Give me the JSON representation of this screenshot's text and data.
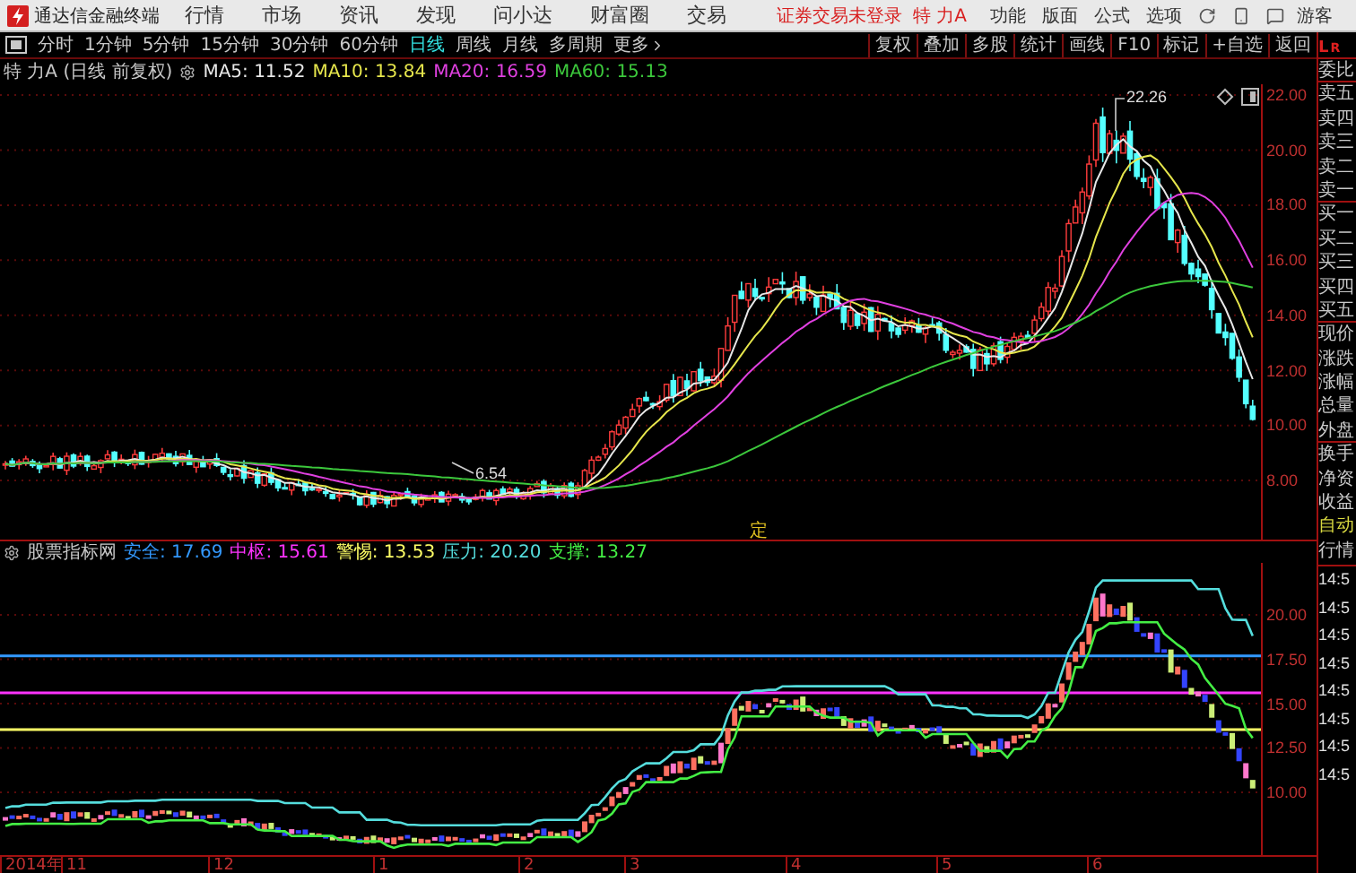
{
  "app_bar": {
    "title": "通达信金融终端",
    "menu": [
      "行情",
      "市场",
      "资讯",
      "发现",
      "问小达",
      "财富圈",
      "交易"
    ],
    "login_status": "证券交易未登录",
    "stock_name": "特 力A",
    "tools": [
      "功能",
      "版面",
      "公式",
      "选项"
    ],
    "user": "游客"
  },
  "period_tabs": [
    {
      "label": "分时",
      "selected": false
    },
    {
      "label": "1分钟",
      "selected": false
    },
    {
      "label": "5分钟",
      "selected": false
    },
    {
      "label": "15分钟",
      "selected": false
    },
    {
      "label": "30分钟",
      "selected": false
    },
    {
      "label": "60分钟",
      "selected": false
    },
    {
      "label": "日线",
      "selected": true
    },
    {
      "label": "周线",
      "selected": false
    },
    {
      "label": "月线",
      "selected": false
    },
    {
      "label": "多周期",
      "selected": false
    },
    {
      "label": "更多",
      "selected": false
    }
  ],
  "chart_tools": [
    "复权",
    "叠加",
    "多股",
    "统计",
    "画线",
    "F10",
    "标记",
    "+自选",
    "返回"
  ],
  "quote_header": {
    "title": "特 力A (日线 前复权)",
    "ma": [
      {
        "label": "MA5: 11.52",
        "color": "#e8e8e8"
      },
      {
        "label": "MA10: 13.84",
        "color": "#e6e64c"
      },
      {
        "label": "MA20: 16.59",
        "color": "#e040e0"
      },
      {
        "label": "MA60: 15.13",
        "color": "#3cc83c"
      }
    ]
  },
  "price_axis": [
    "22.00",
    "20.00",
    "18.00",
    "16.00",
    "14.00",
    "12.00",
    "10.00",
    "8.00"
  ],
  "high_label": "22.26",
  "low_label": "6.54",
  "marker": "定",
  "indicator_header": {
    "title": "股票指标网",
    "values": [
      {
        "label": "安全: 17.69",
        "color": "#3399ff"
      },
      {
        "label": "中枢: 15.61",
        "color": "#ff33ff"
      },
      {
        "label": "警惕: 13.53",
        "color": "#ffff66"
      },
      {
        "label": "压力: 20.20",
        "color": "#55dddd"
      },
      {
        "label": "支撑: 13.27",
        "color": "#44ee44"
      }
    ]
  },
  "lower_axis": [
    "20.00",
    "17.50",
    "15.00",
    "12.50",
    "10.00"
  ],
  "time_axis": [
    "2014年",
    "11",
    "12",
    "1",
    "2",
    "3",
    "4",
    "5",
    "6"
  ],
  "side_panel": {
    "header": [
      "L",
      "R"
    ],
    "quote_labels": [
      "委比",
      "卖五",
      "卖四",
      "卖三",
      "卖二",
      "卖一",
      "买一",
      "买二",
      "买三",
      "买四",
      "买五",
      "现价",
      "涨跌",
      "涨幅",
      "总量",
      "外盘",
      "换手",
      "净资",
      "收益"
    ],
    "mode": "自动",
    "section": "行情",
    "times": [
      "14:5",
      "14:5",
      "14:5",
      "14:5",
      "14:5",
      "14:5",
      "14:5",
      "14:5"
    ]
  }
}
